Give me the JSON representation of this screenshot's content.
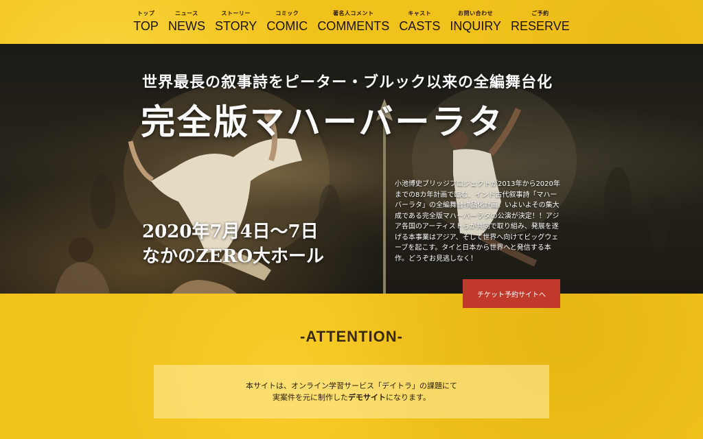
{
  "nav": {
    "items": [
      {
        "sub": "トップ",
        "label": "TOP"
      },
      {
        "sub": "ニュース",
        "label": "NEWS"
      },
      {
        "sub": "ストーリー",
        "label": "STORY"
      },
      {
        "sub": "コミック",
        "label": "COMIC"
      },
      {
        "sub": "著名人コメント",
        "label": "COMMENTS"
      },
      {
        "sub": "キャスト",
        "label": "CASTS"
      },
      {
        "sub": "お問い合わせ",
        "label": "INQUIRY"
      },
      {
        "sub": "ご予約",
        "label": "RESERVE"
      }
    ]
  },
  "hero": {
    "subtitle": "世界最長の叙事詩をピーター・ブルック以来の全編舞台化",
    "title": "完全版マハーバーラタ",
    "date_line1": "2020年7月4日～7日",
    "date_line2": "なかのZERO大ホール",
    "description": "小池博史ブリッジプロジェクトが2013年から2020年までの8カ年計画で臨む、インド古代叙事詩「マハーバーラタ」の全編舞台作品化計画。いよいよその集大成である完全版マハーバーラタの公演が決定！！アジア各国のアーティストらが共同で取り組み、発展を遂げる本事業はアジア、そして世界へ向けてビッグウェーブを起こす。タイと日本から世界へと発信する本作。どうぞお見逃しなく！",
    "ticket_button": "チケット予約サイトへ"
  },
  "attention": {
    "heading": "-ATTENTION-",
    "line1": "本サイトは、オンライン学習サービス「デイトラ」の課題にて",
    "line2_prefix": "実案件を元に制作した",
    "line2_bold": "デモサイト",
    "line2_suffix": "になります。"
  },
  "colors": {
    "background": "#f2c21c",
    "ticket_button": "#c0392b",
    "hero_text": "#ffffff"
  }
}
